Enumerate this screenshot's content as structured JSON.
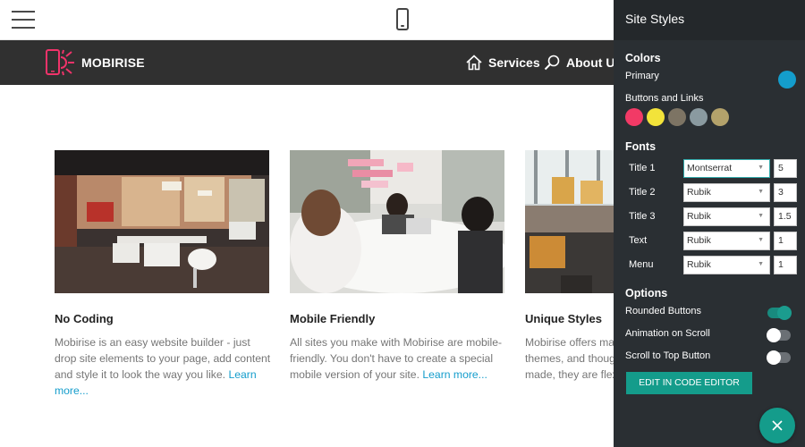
{
  "topbar": {
    "menu_icon": "hamburger-menu-icon",
    "device_icon": "mobile-phone-icon"
  },
  "navbar": {
    "brand": "MOBIRISE",
    "logo_icon": "phone-sun-logo-icon",
    "items": [
      {
        "label": "Services",
        "icon": "home-icon"
      },
      {
        "label": "About Us",
        "icon": "search-icon"
      }
    ]
  },
  "features": [
    {
      "title": "No Coding",
      "image": "open-office-photo",
      "text": "Mobirise is an easy website builder - just drop site elements to your page, add content and style it to look the way you like.",
      "link": "Learn more..."
    },
    {
      "title": "Mobile Friendly",
      "image": "meeting-table-photo",
      "text": "All sites you make with Mobirise are mobile-friendly. You don't have to create a special mobile version of your site.",
      "link": "Learn more..."
    },
    {
      "title": "Unique Styles",
      "image": "office-chairs-photo",
      "lines": [
        "Mobirise offers ma",
        "themes, and thoug",
        "made, they are flex"
      ]
    }
  ],
  "panel": {
    "title": "Site Styles",
    "colors": {
      "heading": "Colors",
      "primary_label": "Primary",
      "primary_color": "#149dcc",
      "buttons_label": "Buttons and Links",
      "swatches": [
        "#f23a66",
        "#f2e33a",
        "#7d7464",
        "#8a9aa0",
        "#b3a26b"
      ]
    },
    "fonts": {
      "heading": "Fonts",
      "rows": [
        {
          "label": "Title 1",
          "font": "Montserrat",
          "size": "5"
        },
        {
          "label": "Title 2",
          "font": "Rubik",
          "size": "3"
        },
        {
          "label": "Title 3",
          "font": "Rubik",
          "size": "1.5"
        },
        {
          "label": "Text",
          "font": "Rubik",
          "size": "1"
        },
        {
          "label": "Menu",
          "font": "Rubik",
          "size": "1"
        }
      ]
    },
    "options": {
      "heading": "Options",
      "items": [
        {
          "label": "Rounded Buttons",
          "on": true
        },
        {
          "label": "Animation on Scroll",
          "on": false
        },
        {
          "label": "Scroll to Top Button",
          "on": false
        }
      ]
    },
    "edit_button": "EDIT IN CODE EDITOR",
    "close_icon": "close-x-icon"
  }
}
